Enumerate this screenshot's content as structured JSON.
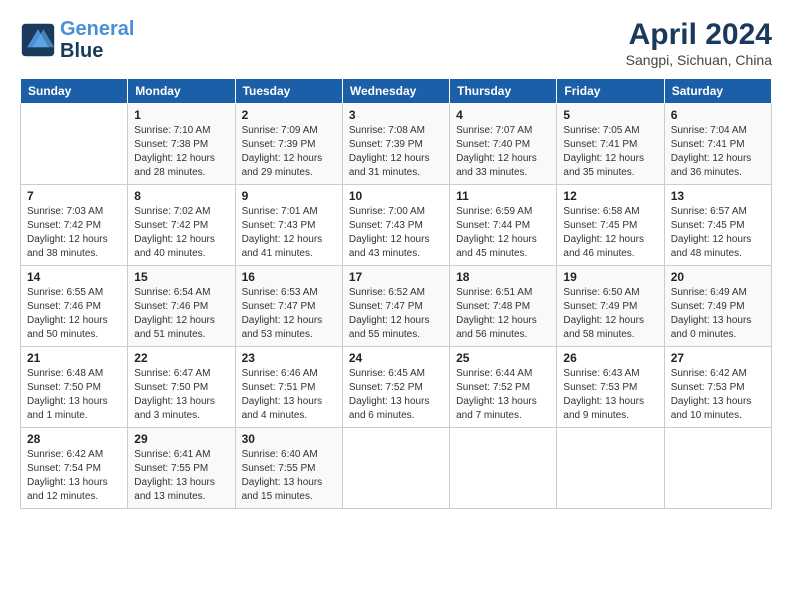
{
  "header": {
    "logo_line1": "General",
    "logo_line2": "Blue",
    "title": "April 2024",
    "subtitle": "Sangpi, Sichuan, China"
  },
  "calendar": {
    "days_of_week": [
      "Sunday",
      "Monday",
      "Tuesday",
      "Wednesday",
      "Thursday",
      "Friday",
      "Saturday"
    ],
    "weeks": [
      [
        {
          "day": "",
          "info": ""
        },
        {
          "day": "1",
          "info": "Sunrise: 7:10 AM\nSunset: 7:38 PM\nDaylight: 12 hours\nand 28 minutes."
        },
        {
          "day": "2",
          "info": "Sunrise: 7:09 AM\nSunset: 7:39 PM\nDaylight: 12 hours\nand 29 minutes."
        },
        {
          "day": "3",
          "info": "Sunrise: 7:08 AM\nSunset: 7:39 PM\nDaylight: 12 hours\nand 31 minutes."
        },
        {
          "day": "4",
          "info": "Sunrise: 7:07 AM\nSunset: 7:40 PM\nDaylight: 12 hours\nand 33 minutes."
        },
        {
          "day": "5",
          "info": "Sunrise: 7:05 AM\nSunset: 7:41 PM\nDaylight: 12 hours\nand 35 minutes."
        },
        {
          "day": "6",
          "info": "Sunrise: 7:04 AM\nSunset: 7:41 PM\nDaylight: 12 hours\nand 36 minutes."
        }
      ],
      [
        {
          "day": "7",
          "info": "Sunrise: 7:03 AM\nSunset: 7:42 PM\nDaylight: 12 hours\nand 38 minutes."
        },
        {
          "day": "8",
          "info": "Sunrise: 7:02 AM\nSunset: 7:42 PM\nDaylight: 12 hours\nand 40 minutes."
        },
        {
          "day": "9",
          "info": "Sunrise: 7:01 AM\nSunset: 7:43 PM\nDaylight: 12 hours\nand 41 minutes."
        },
        {
          "day": "10",
          "info": "Sunrise: 7:00 AM\nSunset: 7:43 PM\nDaylight: 12 hours\nand 43 minutes."
        },
        {
          "day": "11",
          "info": "Sunrise: 6:59 AM\nSunset: 7:44 PM\nDaylight: 12 hours\nand 45 minutes."
        },
        {
          "day": "12",
          "info": "Sunrise: 6:58 AM\nSunset: 7:45 PM\nDaylight: 12 hours\nand 46 minutes."
        },
        {
          "day": "13",
          "info": "Sunrise: 6:57 AM\nSunset: 7:45 PM\nDaylight: 12 hours\nand 48 minutes."
        }
      ],
      [
        {
          "day": "14",
          "info": "Sunrise: 6:55 AM\nSunset: 7:46 PM\nDaylight: 12 hours\nand 50 minutes."
        },
        {
          "day": "15",
          "info": "Sunrise: 6:54 AM\nSunset: 7:46 PM\nDaylight: 12 hours\nand 51 minutes."
        },
        {
          "day": "16",
          "info": "Sunrise: 6:53 AM\nSunset: 7:47 PM\nDaylight: 12 hours\nand 53 minutes."
        },
        {
          "day": "17",
          "info": "Sunrise: 6:52 AM\nSunset: 7:47 PM\nDaylight: 12 hours\nand 55 minutes."
        },
        {
          "day": "18",
          "info": "Sunrise: 6:51 AM\nSunset: 7:48 PM\nDaylight: 12 hours\nand 56 minutes."
        },
        {
          "day": "19",
          "info": "Sunrise: 6:50 AM\nSunset: 7:49 PM\nDaylight: 12 hours\nand 58 minutes."
        },
        {
          "day": "20",
          "info": "Sunrise: 6:49 AM\nSunset: 7:49 PM\nDaylight: 13 hours\nand 0 minutes."
        }
      ],
      [
        {
          "day": "21",
          "info": "Sunrise: 6:48 AM\nSunset: 7:50 PM\nDaylight: 13 hours\nand 1 minute."
        },
        {
          "day": "22",
          "info": "Sunrise: 6:47 AM\nSunset: 7:50 PM\nDaylight: 13 hours\nand 3 minutes."
        },
        {
          "day": "23",
          "info": "Sunrise: 6:46 AM\nSunset: 7:51 PM\nDaylight: 13 hours\nand 4 minutes."
        },
        {
          "day": "24",
          "info": "Sunrise: 6:45 AM\nSunset: 7:52 PM\nDaylight: 13 hours\nand 6 minutes."
        },
        {
          "day": "25",
          "info": "Sunrise: 6:44 AM\nSunset: 7:52 PM\nDaylight: 13 hours\nand 7 minutes."
        },
        {
          "day": "26",
          "info": "Sunrise: 6:43 AM\nSunset: 7:53 PM\nDaylight: 13 hours\nand 9 minutes."
        },
        {
          "day": "27",
          "info": "Sunrise: 6:42 AM\nSunset: 7:53 PM\nDaylight: 13 hours\nand 10 minutes."
        }
      ],
      [
        {
          "day": "28",
          "info": "Sunrise: 6:42 AM\nSunset: 7:54 PM\nDaylight: 13 hours\nand 12 minutes."
        },
        {
          "day": "29",
          "info": "Sunrise: 6:41 AM\nSunset: 7:55 PM\nDaylight: 13 hours\nand 13 minutes."
        },
        {
          "day": "30",
          "info": "Sunrise: 6:40 AM\nSunset: 7:55 PM\nDaylight: 13 hours\nand 15 minutes."
        },
        {
          "day": "",
          "info": ""
        },
        {
          "day": "",
          "info": ""
        },
        {
          "day": "",
          "info": ""
        },
        {
          "day": "",
          "info": ""
        }
      ]
    ]
  }
}
